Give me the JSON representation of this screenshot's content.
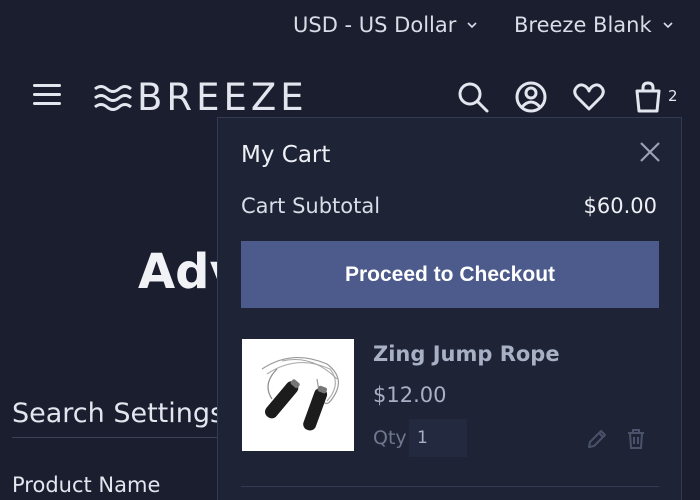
{
  "topbar": {
    "currency": "USD - US Dollar",
    "store": "Breeze Blank"
  },
  "header": {
    "logo_text": "BREEZE",
    "cart_count": "2",
    "icons": [
      "menu-icon",
      "search-icon",
      "account-icon",
      "heart-icon",
      "bag-icon"
    ]
  },
  "background": {
    "title_fragment": "Adv",
    "search_settings": "Search Settings",
    "product_name": "Product Name"
  },
  "cart": {
    "title": "My Cart",
    "subtotal_label": "Cart Subtotal",
    "subtotal_value": "$60.00",
    "checkout_label": "Proceed to Checkout",
    "items": [
      {
        "name": "Zing Jump Rope",
        "price": "$12.00",
        "qty_label": "Qty",
        "qty": "1"
      }
    ]
  },
  "colors": {
    "background": "#1a1e2e",
    "panel": "#1e2335",
    "accent_button": "#4c5b8c",
    "muted_text": "#a8b0c6"
  }
}
